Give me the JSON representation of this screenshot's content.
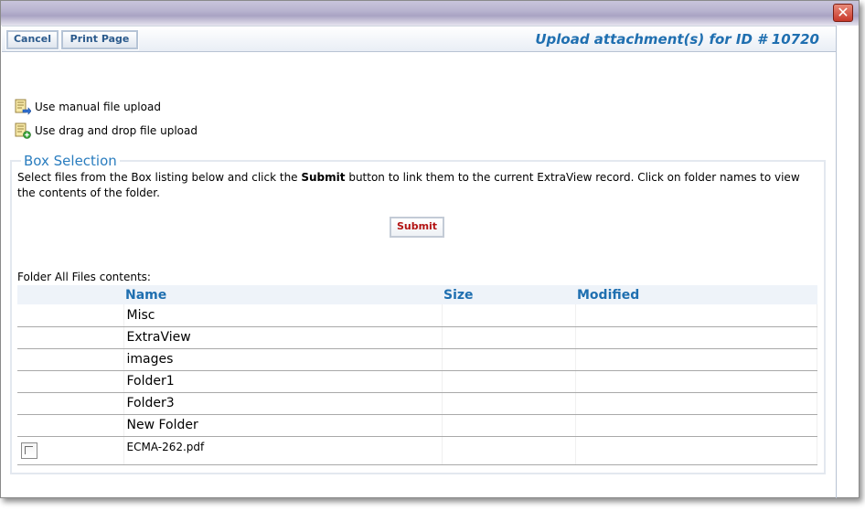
{
  "toolbar": {
    "cancel_label": "Cancel",
    "print_label": "Print Page",
    "title": "Upload attachment(s) for ID # 10720"
  },
  "upload_options": [
    {
      "label": "Use manual file upload",
      "icon": "manual-upload-icon"
    },
    {
      "label": "Use drag and drop file upload",
      "icon": "drag-drop-upload-icon"
    }
  ],
  "box": {
    "legend": "Box Selection",
    "desc_before": "Select files from the Box listing below and click the ",
    "desc_bold": "Submit",
    "desc_after": " button to link them to the current ExtraView record. Click on folder names to view the contents of the folder.",
    "submit_label": "Submit",
    "folder_label": "Folder All Files contents:",
    "columns": {
      "name": "Name",
      "size": "Size",
      "modified": "Modified"
    },
    "rows": [
      {
        "name": "Misc",
        "type": "folder"
      },
      {
        "name": "ExtraView",
        "type": "folder"
      },
      {
        "name": "images",
        "type": "folder"
      },
      {
        "name": "Folder1",
        "type": "folder"
      },
      {
        "name": "Folder3",
        "type": "folder"
      },
      {
        "name": "New Folder",
        "type": "folder"
      },
      {
        "name": "ECMA-262.pdf",
        "type": "file"
      }
    ]
  },
  "colors": {
    "accent": "#1f6fb0",
    "submit_text": "#b31313",
    "close_button": "#c8382a"
  }
}
